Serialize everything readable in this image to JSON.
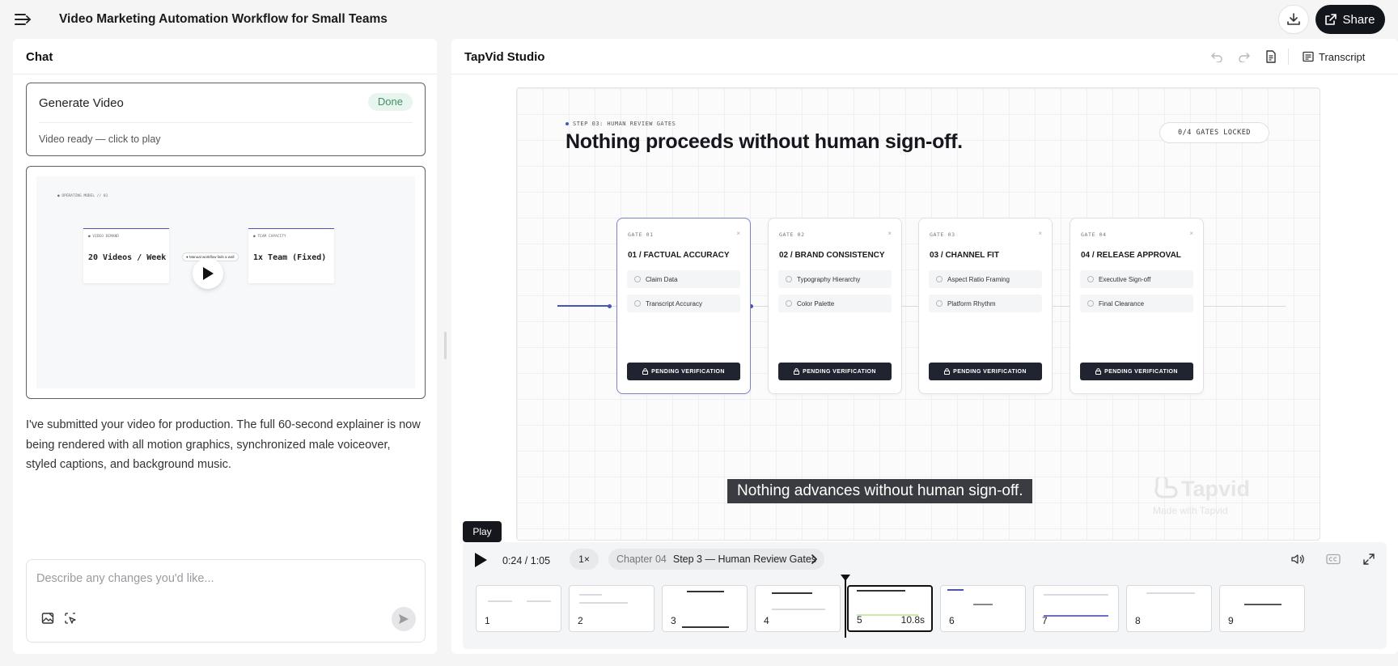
{
  "topbar": {
    "title": "Video Marketing Automation Workflow for Small Teams",
    "share_label": "Share"
  },
  "chat": {
    "header": "Chat",
    "generate_card": {
      "title": "Generate Video",
      "status": "Done",
      "subtitle": "Video ready — click to play"
    },
    "video_preview": {
      "section_label": "● OPERATING MODEL // 01",
      "left_box_label": "● VIDEO DEMAND",
      "left_box_value": "20 Videos / Week",
      "right_box_label": "● TEAM CAPACITY",
      "right_box_value": "1x Team (Fixed)",
      "middle_pill": "● Manual workflow fails a wall"
    },
    "assistant_message": "I've submitted your video for production. The full 60-second explainer is now being rendered with all motion graphics, synchronized male voiceover, styled captions, and background music.",
    "input_placeholder": "Describe any changes you'd like..."
  },
  "studio": {
    "header": "TapVid Studio",
    "transcript_label": "Transcript",
    "slide": {
      "step_label": "STEP 03: HUMAN REVIEW GATES",
      "title": "Nothing proceeds without human sign-off.",
      "gates_status": "0/4 GATES LOCKED",
      "gates": [
        {
          "num": "GATE 01",
          "title": "01 / FACTUAL ACCURACY",
          "items": [
            "Claim Data",
            "Transcript Accuracy"
          ],
          "button": "PENDING VERIFICATION"
        },
        {
          "num": "GATE 02",
          "title": "02 / BRAND CONSISTENCY",
          "items": [
            "Typography Hierarchy",
            "Color Palette"
          ],
          "button": "PENDING VERIFICATION"
        },
        {
          "num": "GATE 03",
          "title": "03 / CHANNEL FIT",
          "items": [
            "Aspect Ratio Framing",
            "Platform Rhythm"
          ],
          "button": "PENDING VERIFICATION"
        },
        {
          "num": "GATE 04",
          "title": "04 / RELEASE APPROVAL",
          "items": [
            "Executive Sign-off",
            "Final Clearance"
          ],
          "button": "PENDING VERIFICATION"
        }
      ],
      "caption": "Nothing advances without human sign-off.",
      "watermark_brand": "Tapvid",
      "watermark_sub": "Made with Tapvid"
    },
    "controls": {
      "tooltip": "Play",
      "time": "0:24 / 1:05",
      "speed": "1×",
      "chapter_num": "Chapter 04",
      "chapter_title": "Step 3 — Human Review Gates"
    },
    "thumbnails": [
      {
        "num": "1",
        "duration": ""
      },
      {
        "num": "2",
        "duration": ""
      },
      {
        "num": "3",
        "duration": ""
      },
      {
        "num": "4",
        "duration": ""
      },
      {
        "num": "5",
        "duration": "10.8s"
      },
      {
        "num": "6",
        "duration": ""
      },
      {
        "num": "7",
        "duration": ""
      },
      {
        "num": "8",
        "duration": ""
      },
      {
        "num": "9",
        "duration": ""
      }
    ],
    "active_thumbnail": 5
  }
}
